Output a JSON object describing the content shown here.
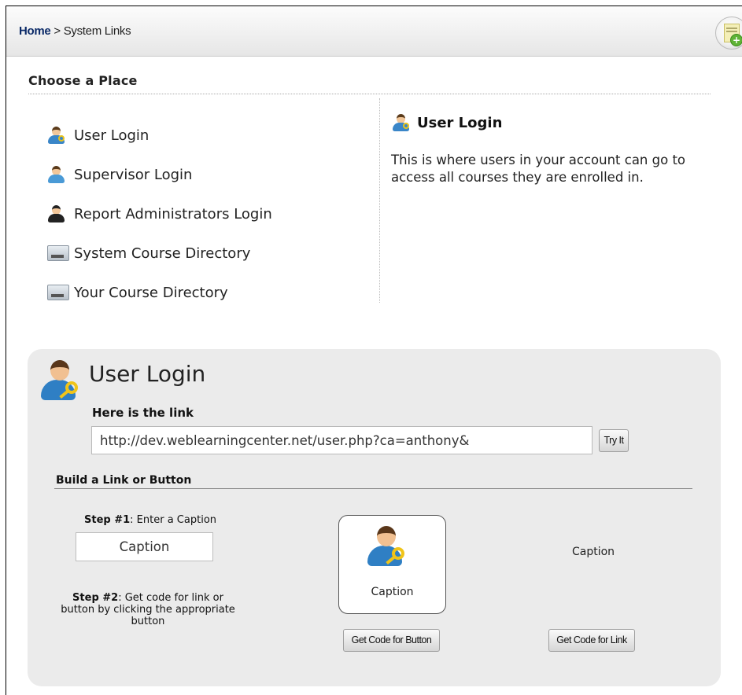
{
  "breadcrumb": {
    "home": "Home",
    "separator": " > ",
    "current": "System Links"
  },
  "add_button_icon": "add-bookmark-icon",
  "choose": {
    "heading": "Choose a Place",
    "places": [
      {
        "label": "User Login",
        "icon": "user-login-icon"
      },
      {
        "label": "Supervisor Login",
        "icon": "supervisor-icon"
      },
      {
        "label": "Report Administrators Login",
        "icon": "administrator-icon"
      },
      {
        "label": "System Course Directory",
        "icon": "directory-icon"
      },
      {
        "label": "Your Course Directory",
        "icon": "directory-icon"
      }
    ]
  },
  "detail": {
    "title": "User Login",
    "description": "This is where users in your account can go to access all courses they are enrolled in."
  },
  "panel": {
    "title": "User Login",
    "link_label": "Here is the link",
    "link_value": "http://dev.weblearningcenter.net/user.php?ca=anthony&",
    "try_button": "Try It",
    "build_heading": "Build a Link or Button",
    "step1_prefix": "Step #1",
    "step1_text": ": Enter a Caption",
    "caption_value": "Caption",
    "step2_prefix": "Step #2",
    "step2_text": ": Get code for link or button by clicking the appropriate button",
    "preview_button_caption": "Caption",
    "preview_link_caption": "Caption",
    "get_code_button": "Get Code for Button",
    "get_code_link": "Get Code for Link"
  }
}
